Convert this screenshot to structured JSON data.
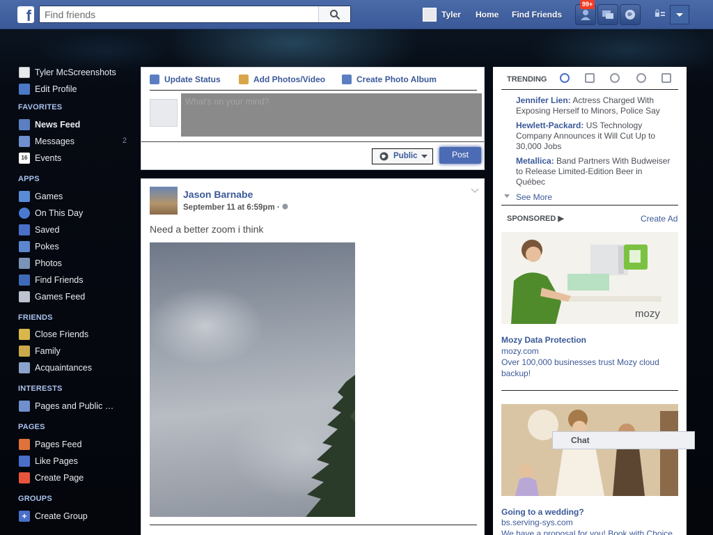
{
  "topbar": {
    "search_placeholder": "Find friends",
    "user_name": "Tyler",
    "home_label": "Home",
    "find_friends_label": "Find Friends",
    "notif_count": "99+",
    "brand_color": "#3b5998"
  },
  "leftnav": {
    "profile_name": "Tyler McScreenshots",
    "edit_profile": "Edit Profile",
    "sections": {
      "favorites": "FAVORITES",
      "apps": "APPS",
      "friends": "FRIENDS",
      "interests": "INTERESTS",
      "pages": "PAGES",
      "groups": "GROUPS"
    },
    "favorites": [
      {
        "label": "News Feed",
        "icon": "news-feed-icon"
      },
      {
        "label": "Messages",
        "icon": "messages-icon",
        "count": "2"
      },
      {
        "label": "Events",
        "icon": "events-icon"
      }
    ],
    "apps": [
      {
        "label": "Games",
        "icon": "games-icon"
      },
      {
        "label": "On This Day",
        "icon": "on-this-day-icon"
      },
      {
        "label": "Saved",
        "icon": "saved-icon"
      },
      {
        "label": "Pokes",
        "icon": "pokes-icon"
      },
      {
        "label": "Photos",
        "icon": "photos-icon"
      },
      {
        "label": "Find Friends",
        "icon": "find-friends-icon"
      },
      {
        "label": "Games Feed",
        "icon": "games-feed-icon"
      }
    ],
    "friends": [
      {
        "label": "Close Friends",
        "icon": "close-friends-icon"
      },
      {
        "label": "Family",
        "icon": "family-icon"
      },
      {
        "label": "Acquaintances",
        "icon": "acquaintances-icon"
      }
    ],
    "interests": [
      {
        "label": "Pages and Public …",
        "icon": "pages-public-icon"
      }
    ],
    "pages": [
      {
        "label": "Pages Feed",
        "icon": "pages-feed-icon"
      },
      {
        "label": "Like Pages",
        "icon": "like-pages-icon"
      },
      {
        "label": "Create Page",
        "icon": "create-page-icon"
      }
    ],
    "groups": [
      {
        "label": "Create Group",
        "icon": "create-group-icon"
      }
    ]
  },
  "composer": {
    "tab_status": "Update Status",
    "tab_photos": "Add Photos/Video",
    "tab_album": "Create Photo Album",
    "placeholder": "What's on your mind?",
    "privacy": "Public",
    "post_label": "Post"
  },
  "post": {
    "author": "Jason Barnabe",
    "timestamp": "September 11 at 6:59pm ·",
    "text": "Need a better zoom i think"
  },
  "trending": {
    "heading": "TRENDING",
    "items": [
      {
        "name": "Jennifer Lien:",
        "text": "Actress Charged With Exposing Herself to Minors, Police Say"
      },
      {
        "name": "Hewlett-Packard:",
        "text": "US Technology Company Announces it Will Cut Up to 30,000 Jobs"
      },
      {
        "name": "Metallica:",
        "text": "Band Partners With Budweiser to Release Limited-Edition Beer in Québec"
      }
    ],
    "see_more": "See More"
  },
  "sponsored": {
    "heading": "SPONSORED",
    "create_ad": "Create Ad",
    "ads": [
      {
        "logo": "mozy",
        "title": "Mozy Data Protection",
        "domain": "mozy.com",
        "desc": "Over 100,000 businesses trust Mozy cloud backup!"
      },
      {
        "title": "Going to a wedding?",
        "domain": "bs.serving-sys.com",
        "desc": "We have a proposal for you! Book with Choice"
      }
    ]
  },
  "chat": {
    "label": "Chat"
  }
}
